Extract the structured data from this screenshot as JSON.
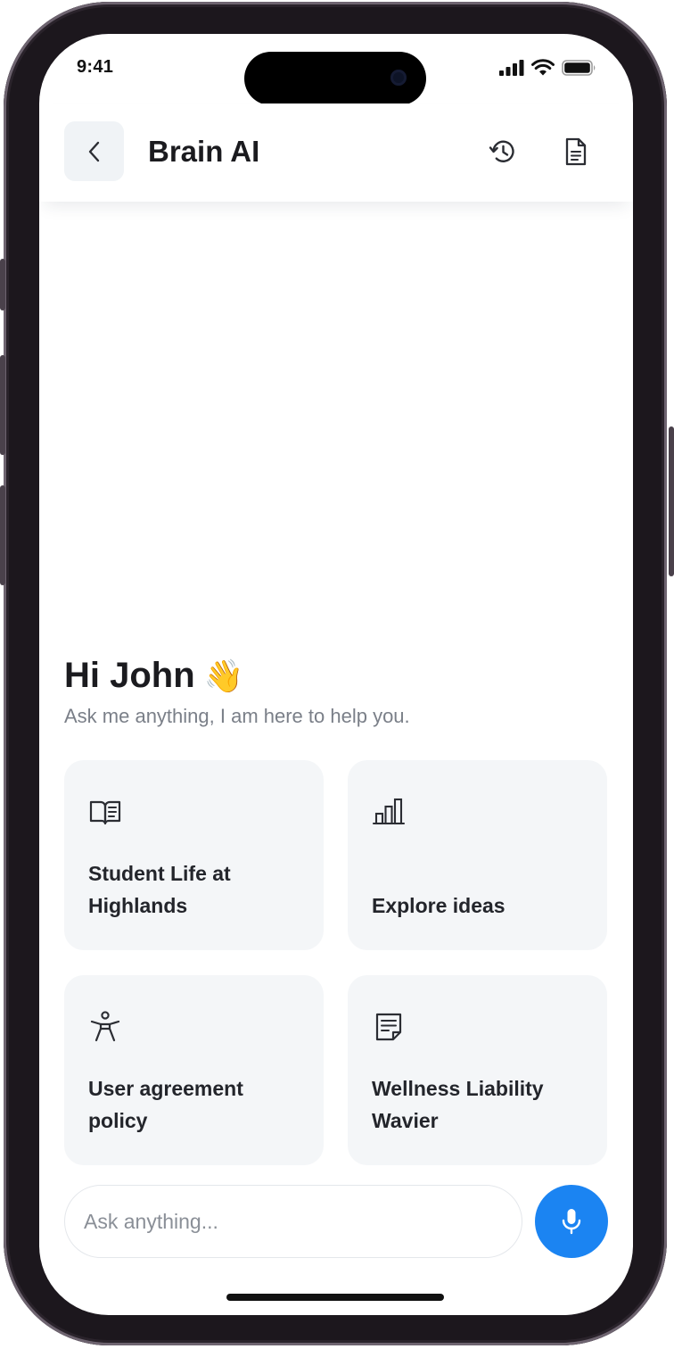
{
  "status_bar": {
    "time": "9:41",
    "icons": [
      "signal-icon",
      "wifi-icon",
      "battery-icon"
    ]
  },
  "header": {
    "title": "Brain AI",
    "back_icon": "chevron-left-icon",
    "history_icon": "history-icon",
    "document_icon": "document-icon"
  },
  "greeting": {
    "title": "Hi John",
    "emoji": "👋",
    "subtitle": "Ask me anything, I am here to help you."
  },
  "cards": [
    {
      "label": "Student Life at Highlands",
      "icon": "book-icon"
    },
    {
      "label": "Explore ideas",
      "icon": "bar-chart-icon"
    },
    {
      "label": "User agreement policy",
      "icon": "accessibility-icon"
    },
    {
      "label": "Wellness Liability Wavier",
      "icon": "note-icon"
    }
  ],
  "input": {
    "placeholder": "Ask anything...",
    "value": ""
  },
  "mic_icon": "microphone-icon",
  "colors": {
    "accent": "#1b84f2",
    "card_bg": "#f4f6f8",
    "text_primary": "#1b1b1f",
    "text_secondary": "#7a7f88",
    "frame": "#1c171d"
  }
}
